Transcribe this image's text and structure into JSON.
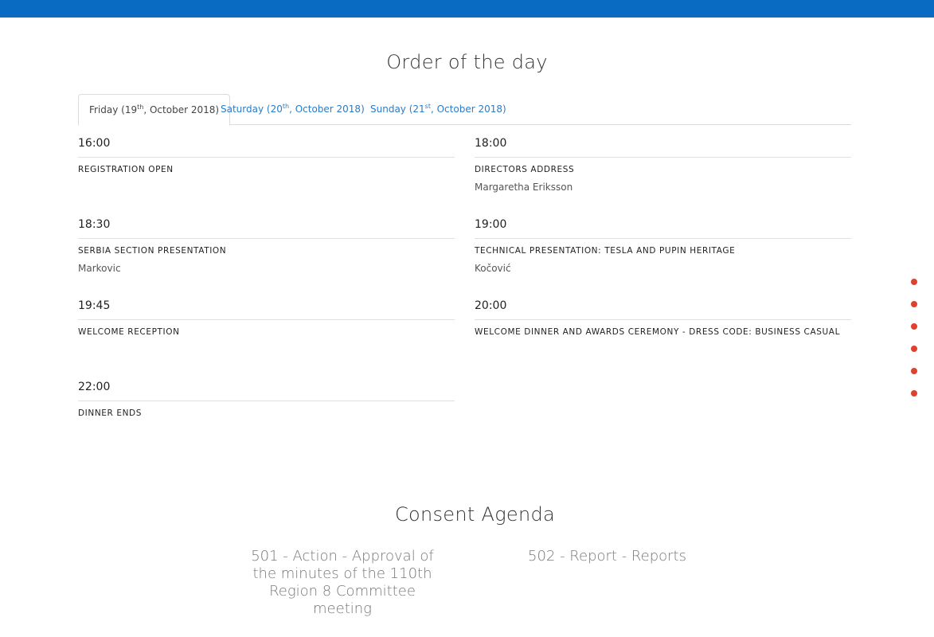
{
  "order_title": "Order of the day",
  "tabs": [
    {
      "day": "Friday (19",
      "sup": "th",
      "rest": ", October 2018)"
    },
    {
      "day": "Saturday (20",
      "sup": "th",
      "rest": ", October 2018)"
    },
    {
      "day": "Sunday (21",
      "sup": "st",
      "rest": ", October 2018)"
    }
  ],
  "events": [
    {
      "time": "16:00",
      "title": "REGISTRATION OPEN",
      "speaker": ""
    },
    {
      "time": "18:00",
      "title": "DIRECTORS ADDRESS",
      "speaker": "Margaretha Eriksson"
    },
    {
      "time": "18:30",
      "title": "SERBIA SECTION PRESENTATION",
      "speaker": "Markovic"
    },
    {
      "time": "19:00",
      "title": "TECHNICAL PRESENTATION: TESLA AND PUPIN HERITAGE",
      "speaker": "Kočović"
    },
    {
      "time": "19:45",
      "title": "WELCOME RECEPTION",
      "speaker": ""
    },
    {
      "time": "20:00",
      "title": "WELCOME DINNER AND AWARDS CEREMONY - DRESS CODE: BUSINESS CASUAL",
      "speaker": ""
    },
    {
      "time": "22:00",
      "title": "DINNER ENDS",
      "speaker": ""
    }
  ],
  "consent_title": "Consent Agenda",
  "consent_items": [
    "501 - Action - Approval of the minutes of the 110th Region 8 Committee meeting",
    "502 - Report - Reports"
  ],
  "colors": {
    "topbar": "#0a6bc2",
    "link": "#2b7bc7",
    "dot": "#e0412f"
  }
}
